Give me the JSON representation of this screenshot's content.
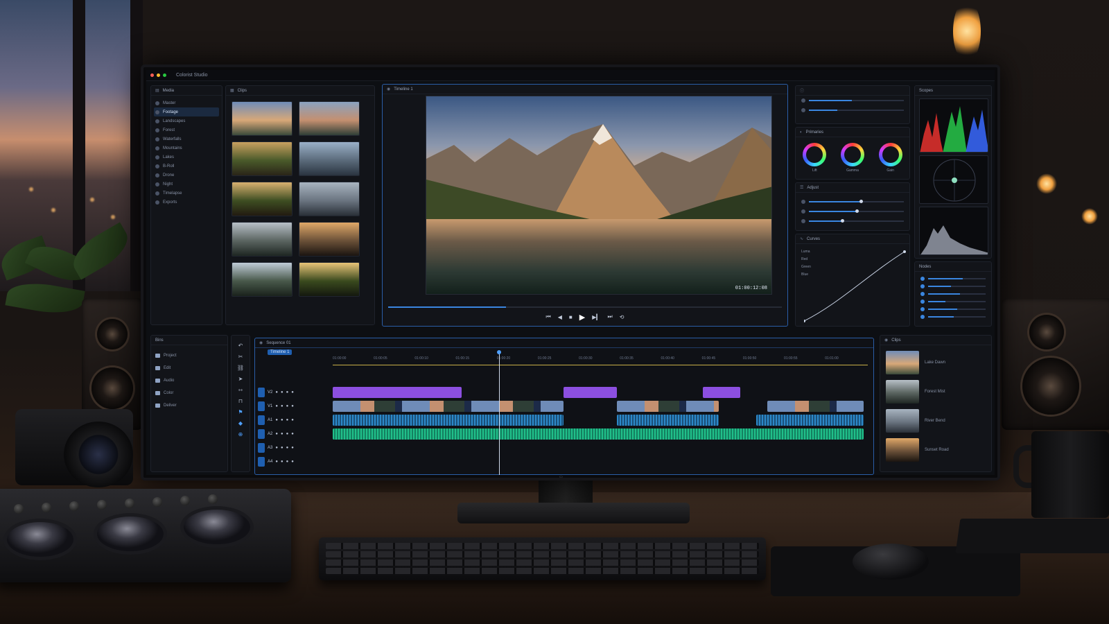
{
  "app": {
    "window_title": "Colorist Studio",
    "accent": "#3a86e0",
    "clip_colors": {
      "title": "#8c4fe0",
      "video": "#2c5fa8",
      "audio_1": "#2c88c8",
      "audio_2": "#20c08a"
    }
  },
  "media_pool": {
    "header": "Media",
    "folders": [
      "Master",
      "Footage",
      "Landscapes",
      "Forest",
      "Waterfalls",
      "Mountains",
      "Lakes",
      "B-Roll",
      "Drone",
      "Night",
      "Timelapse",
      "Exports"
    ],
    "active_folder_index": 1,
    "thumbnail_header": "Clips",
    "thumbnail_scenes": [
      "mountain-lake",
      "mountain-lake-2",
      "forest-road",
      "mountain-hiker",
      "forest-path",
      "misty-lake",
      "misty-forest",
      "hiker-sunset",
      "waterfall",
      "forest-sunbeam"
    ]
  },
  "viewer": {
    "header": "Timeline 1",
    "timecode": "01:00:12:08",
    "progress": 0.3,
    "transport": [
      "skip-back-icon",
      "prev-frame-icon",
      "stop-icon",
      "play-icon",
      "next-frame-icon",
      "skip-forward-icon",
      "loop-icon"
    ]
  },
  "color": {
    "primaries_header": "Primaries",
    "wheels": [
      "Lift",
      "Gamma",
      "Gain"
    ],
    "adjust_header": "Adjust",
    "sliders": [
      0.55,
      0.5,
      0.35
    ],
    "curves_header": "Curves",
    "curve_labels": [
      "Luma",
      "Red",
      "Green",
      "Blue"
    ]
  },
  "scopes": {
    "header": "Scopes",
    "nodes_header": "Nodes",
    "node_levels": [
      0.6,
      0.4,
      0.55,
      0.3,
      0.5,
      0.45
    ]
  },
  "bins": {
    "header": "Bins",
    "items": [
      "Project",
      "Edit",
      "Audio",
      "Color",
      "Deliver"
    ]
  },
  "timeline": {
    "header": "Sequence 01",
    "tab": "Timeline 1",
    "ruler": [
      "01:00:00",
      "01:00:05",
      "01:00:10",
      "01:00:15",
      "01:00:20",
      "01:00:25",
      "01:00:30",
      "01:00:35",
      "01:00:40",
      "01:00:45",
      "01:00:50",
      "01:00:55",
      "01:01:00"
    ],
    "tracks": [
      "V2",
      "V1",
      "A1",
      "A2",
      "A3",
      "A4"
    ],
    "playhead": 0.31
  },
  "clip_list": {
    "header": "Clips",
    "items": [
      "Lake Dawn",
      "Forest Mist",
      "River Bend",
      "Sunset Road"
    ]
  }
}
